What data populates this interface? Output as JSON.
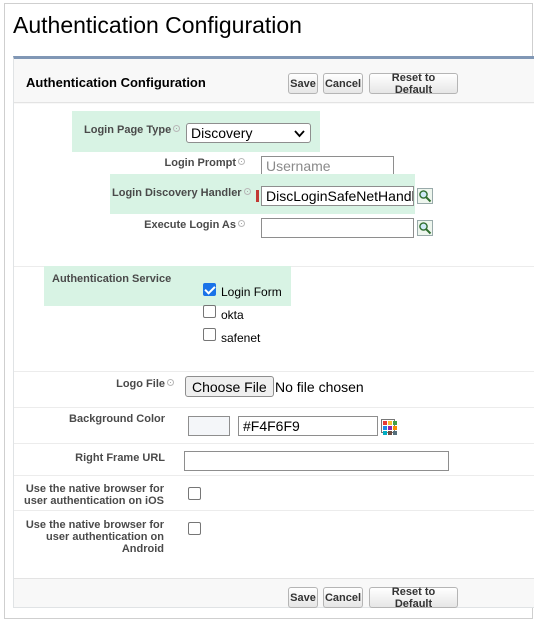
{
  "page": {
    "title": "Authentication Configuration"
  },
  "block": {
    "title": "Authentication Configuration"
  },
  "buttons": {
    "save": "Save",
    "cancel": "Cancel",
    "reset": "Reset to Default"
  },
  "fields": {
    "login_page_type": {
      "label": "Login Page Type",
      "value": "Discovery"
    },
    "login_prompt": {
      "label": "Login Prompt",
      "placeholder": "Username"
    },
    "login_discovery_handler": {
      "label": "Login Discovery Handler",
      "value": "DiscLoginSafeNetHandler"
    },
    "execute_login_as": {
      "label": "Execute Login As",
      "value": ""
    },
    "authentication_service": {
      "label": "Authentication Service",
      "options": [
        {
          "label": "Login Form",
          "checked": true
        },
        {
          "label": "okta",
          "checked": false
        },
        {
          "label": "safenet",
          "checked": false
        }
      ]
    },
    "logo_file": {
      "label": "Logo File",
      "button": "Choose File",
      "status": "No file chosen"
    },
    "background_color": {
      "label": "Background Color",
      "value": "#F4F6F9",
      "swatch_color": "#F4F6F9"
    },
    "right_frame_url": {
      "label": "Right Frame URL",
      "value": ""
    },
    "native_browser_ios": {
      "label_lines": [
        "Use the native browser for",
        "user authentication on iOS"
      ],
      "checked": false
    },
    "native_browser_android": {
      "label_lines": [
        "Use the native browser for",
        "user authentication on",
        "Android"
      ],
      "checked": false
    }
  },
  "colors": {
    "highlight": "#d8f3e4",
    "panel_border": "#8097b5",
    "required": "#c23934",
    "checkbox_accent": "#1a73e8"
  }
}
